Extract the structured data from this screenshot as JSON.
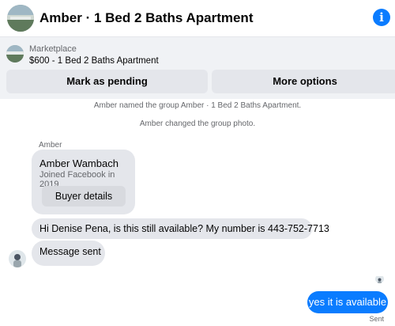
{
  "header": {
    "title": "Amber · 1 Bed 2 Baths Apartment",
    "info_icon": "info-icon"
  },
  "marketplace": {
    "label": "Marketplace",
    "listing": "$600 - 1 Bed 2 Baths Apartment",
    "mark_pending_label": "Mark as pending",
    "more_options_label": "More options"
  },
  "chat": {
    "system_messages": [
      "Amber named the group Amber · 1 Bed 2 Baths Apartment.",
      "Amber changed the group photo."
    ],
    "sender_name": "Amber",
    "profile_card": {
      "name": "Amber Wambach",
      "joined": "Joined Facebook in 2019",
      "button_label": "Buyer details"
    },
    "incoming": [
      "Hi Denise Pena, is this still available? My number is 443-752-7713",
      "Message sent"
    ],
    "outgoing": "yes it is available",
    "status": "Sent"
  },
  "colors": {
    "accent": "#0a7cff",
    "bubble_gray": "#e4e6eb",
    "panel_bg": "#f0f2f5",
    "secondary_text": "#65676b"
  }
}
